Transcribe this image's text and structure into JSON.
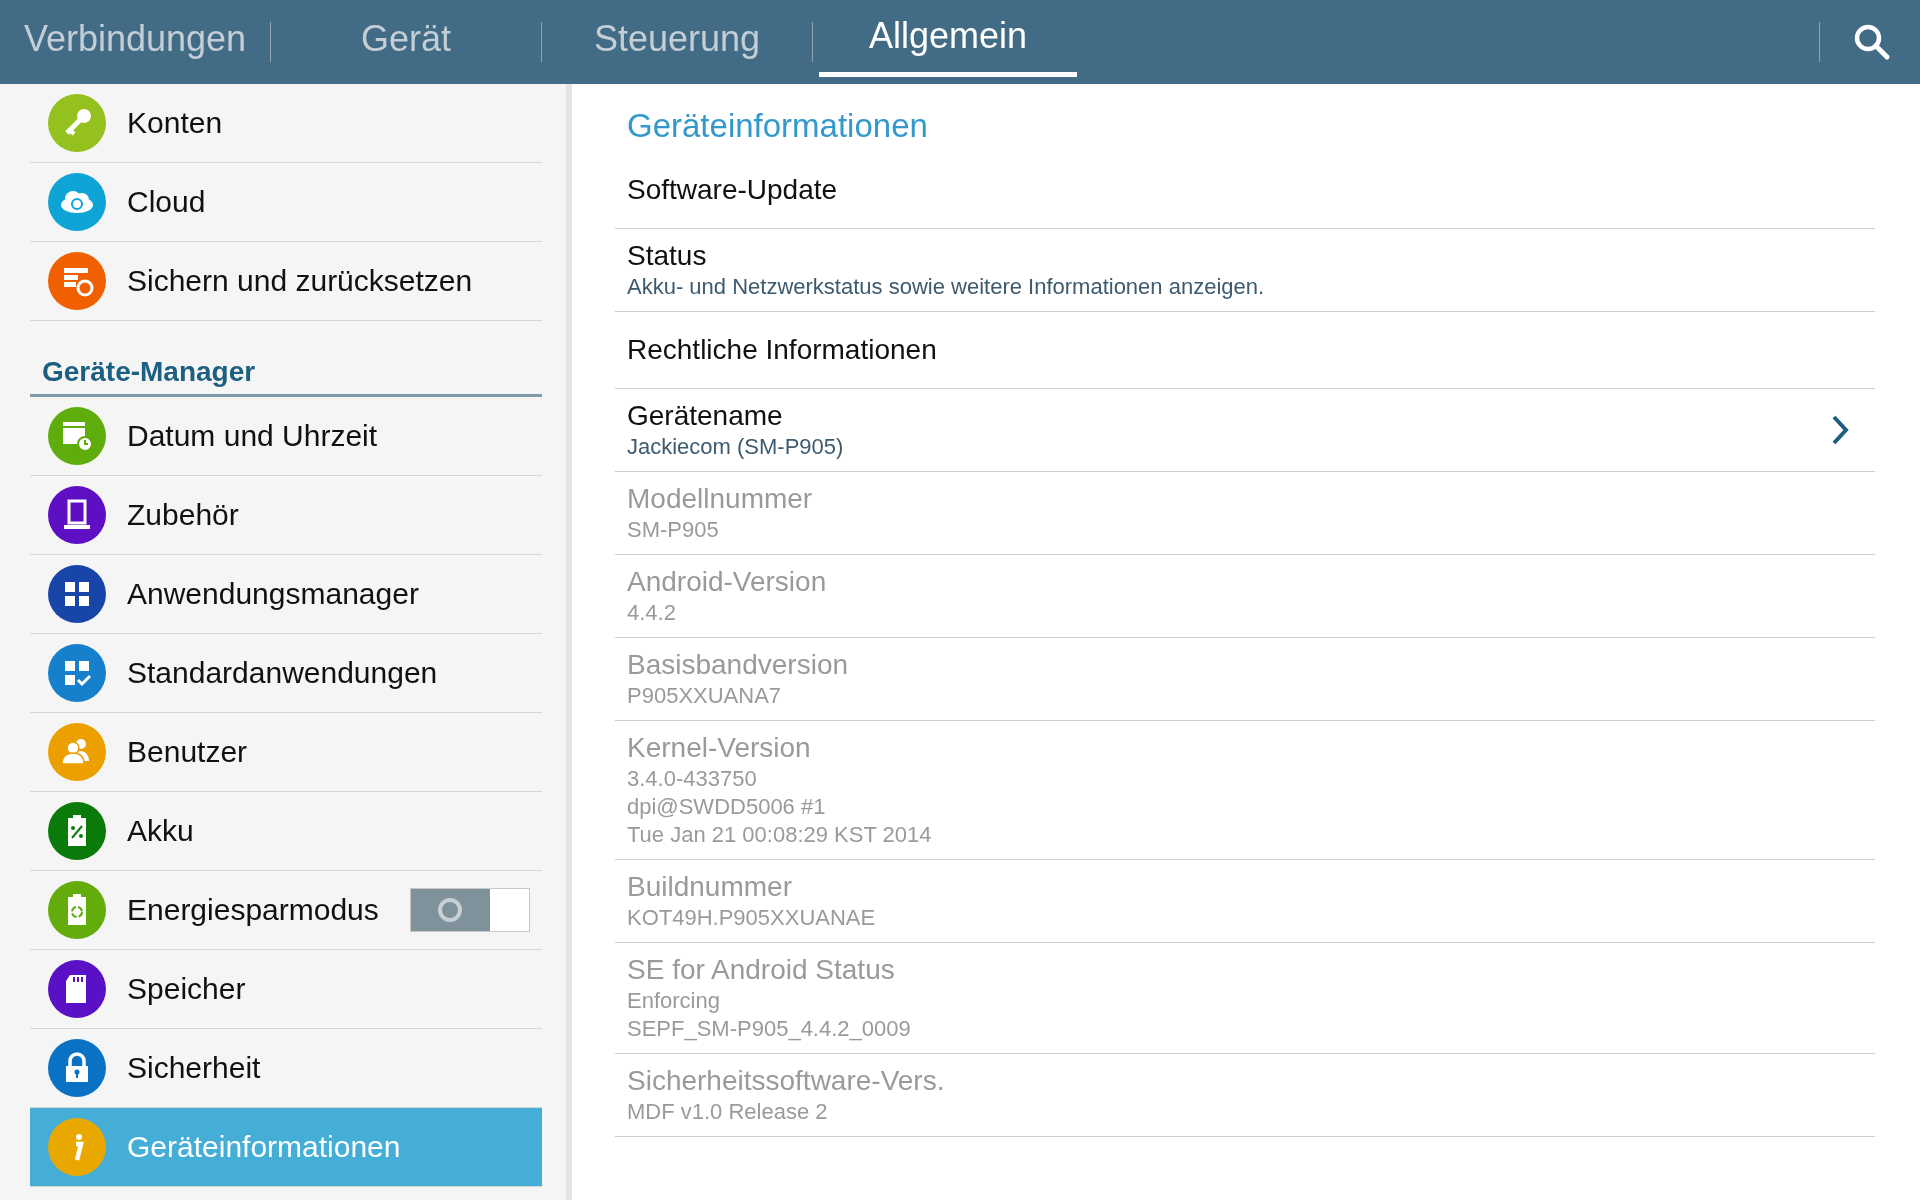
{
  "tabs": [
    {
      "label": "Verbindungen",
      "selected": false
    },
    {
      "label": "Gerät",
      "selected": false
    },
    {
      "label": "Steuerung",
      "selected": false
    },
    {
      "label": "Allgemein",
      "selected": true
    }
  ],
  "sidebar": {
    "groups": [
      {
        "items": [
          {
            "label": "Konten",
            "color": "#95c11f",
            "selected": false,
            "kind": "plain"
          },
          {
            "label": "Cloud",
            "color": "#0ea5d6",
            "selected": false,
            "kind": "plain"
          },
          {
            "label": "Sichern und zurücksetzen",
            "color": "#f06000",
            "selected": false,
            "kind": "plain"
          }
        ]
      },
      {
        "title": "Geräte-Manager",
        "items": [
          {
            "label": "Datum und Uhrzeit",
            "color": "#5fad0c",
            "selected": false,
            "kind": "plain"
          },
          {
            "label": "Zubehör",
            "color": "#5e0fc4",
            "selected": false,
            "kind": "plain"
          },
          {
            "label": "Anwendungsmanager",
            "color": "#1746a8",
            "selected": false,
            "kind": "plain"
          },
          {
            "label": "Standardanwendungen",
            "color": "#1680cc",
            "selected": false,
            "kind": "plain"
          },
          {
            "label": "Benutzer",
            "color": "#eba000",
            "selected": false,
            "kind": "plain"
          },
          {
            "label": "Akku",
            "color": "#0a7a0a",
            "selected": false,
            "kind": "plain"
          },
          {
            "label": "Energiesparmodus",
            "color": "#62ad0b",
            "selected": false,
            "kind": "toggle",
            "on": false
          },
          {
            "label": "Speicher",
            "color": "#5a10c4",
            "selected": false,
            "kind": "plain"
          },
          {
            "label": "Sicherheit",
            "color": "#0a72c4",
            "selected": false,
            "kind": "plain"
          },
          {
            "label": "Geräteinformationen",
            "color": "#e8a800",
            "selected": true,
            "kind": "plain"
          }
        ]
      }
    ]
  },
  "content": {
    "title": "Geräteinformationen",
    "items": [
      {
        "title": "Software-Update",
        "disabled": false,
        "kind": "plain"
      },
      {
        "title": "Status",
        "details": [
          "Akku- und Netzwerkstatus sowie weitere Informationen anzeigen."
        ],
        "disabled": false,
        "kind": "plain"
      },
      {
        "title": "Rechtliche Informationen",
        "disabled": false,
        "kind": "plain"
      },
      {
        "title": "Gerätename",
        "details": [
          "Jackiecom (SM-P905)"
        ],
        "disabled": false,
        "kind": "nav"
      },
      {
        "title": "Modellnummer",
        "details": [
          "SM-P905"
        ],
        "disabled": true,
        "kind": "plain"
      },
      {
        "title": "Android-Version",
        "details": [
          "4.4.2"
        ],
        "disabled": true,
        "kind": "plain"
      },
      {
        "title": "Basisbandversion",
        "details": [
          "P905XXUANA7"
        ],
        "disabled": true,
        "kind": "plain"
      },
      {
        "title": "Kernel-Version",
        "details": [
          "3.4.0-433750",
          "dpi@SWDD5006 #1",
          "Tue Jan 21 00:08:29 KST 2014"
        ],
        "disabled": true,
        "kind": "plain"
      },
      {
        "title": "Buildnummer",
        "details": [
          "KOT49H.P905XXUANAE"
        ],
        "disabled": true,
        "kind": "plain"
      },
      {
        "title": "SE for Android Status",
        "details": [
          "Enforcing",
          "SEPF_SM-P905_4.4.2_0009"
        ],
        "disabled": true,
        "kind": "plain"
      },
      {
        "title": "Sicherheitssoftware-Vers.",
        "details": [
          "MDF v1.0 Release 2"
        ],
        "disabled": true,
        "kind": "plain"
      }
    ]
  }
}
